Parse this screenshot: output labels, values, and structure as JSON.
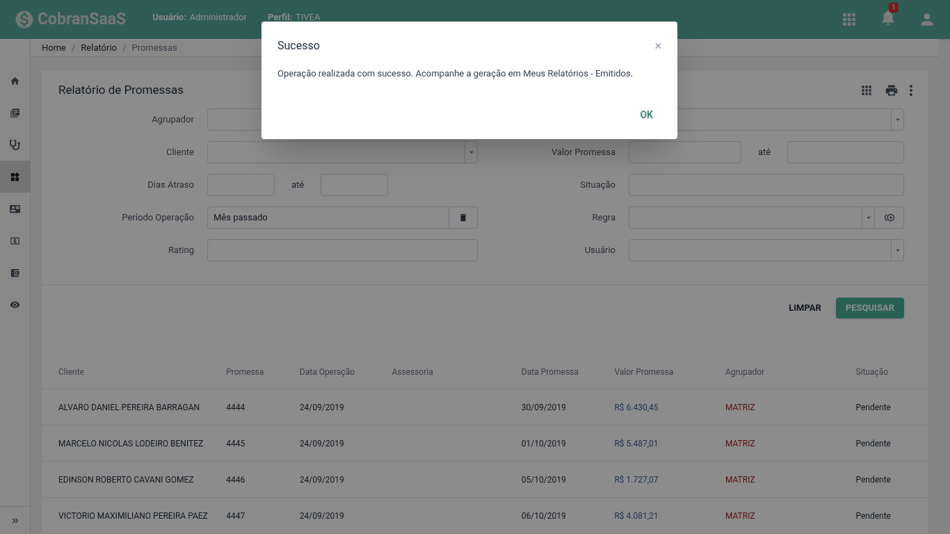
{
  "header": {
    "logo": "CobranSaaS",
    "user_label": "Usuário:",
    "user": "Administrador",
    "profile_label": "Perfil:",
    "profile": "TIVEA",
    "notifications": "1"
  },
  "sidebar": {
    "items": [
      {
        "selected": false
      },
      {
        "selected": false
      },
      {
        "selected": false
      },
      {
        "selected": true
      },
      {
        "selected": false
      },
      {
        "selected": false
      },
      {
        "selected": false
      },
      {
        "selected": false
      }
    ]
  },
  "breadcrumb": [
    "Home",
    "Relatório",
    "Promessas"
  ],
  "breadcrumb_separator": "/",
  "card": {
    "title": "Relatório de Promessas"
  },
  "filters_left": [
    {
      "label": "Agrupador",
      "kind": "text"
    },
    {
      "label": "Cliente",
      "kind": "select"
    },
    {
      "label": "Dias Atraso",
      "kind": "range",
      "separator": "até"
    },
    {
      "label": "Período Operação",
      "kind": "clearable",
      "value": "Mês passado"
    },
    {
      "label": "Rating",
      "kind": "text"
    }
  ],
  "filters_right": [
    {
      "kind": "select"
    },
    {
      "label": "Valor Promessa",
      "kind": "range",
      "separator": "até"
    },
    {
      "label": "Situação",
      "kind": "text"
    },
    {
      "label": "Regra",
      "kind": "select-add"
    },
    {
      "label": "Usuário",
      "kind": "select"
    }
  ],
  "actions": {
    "clear": "LIMPAR",
    "search": "PESQUISAR"
  },
  "table": {
    "columns": [
      "Cliente",
      "Promessa",
      "Data Operação",
      "Assessoria",
      "Data Promessa",
      "Valor Promessa",
      "Agrupador",
      "Situação"
    ],
    "rows": [
      [
        "ALVARO DANIEL PEREIRA BARRAGAN",
        "4444",
        "24/09/2019",
        "",
        "30/09/2019",
        "R$ 6.430,45",
        "MATRIZ",
        "Pendente"
      ],
      [
        "MARCELO NICOLAS LODEIRO BENITEZ",
        "4445",
        "24/09/2019",
        "",
        "01/10/2019",
        "R$ 5.487,01",
        "MATRIZ",
        "Pendente"
      ],
      [
        "EDINSON ROBERTO CAVANI GOMEZ",
        "4446",
        "24/09/2019",
        "",
        "05/10/2019",
        "R$ 1.727,07",
        "MATRIZ",
        "Pendente"
      ],
      [
        "VICTORIO MAXIMILIANO PEREIRA PAEZ",
        "4447",
        "24/09/2019",
        "",
        "06/10/2019",
        "R$ 4.081,21",
        "MATRIZ",
        "Pendente"
      ]
    ]
  },
  "dialog": {
    "title": "Sucesso",
    "close": "×",
    "message": "Operação realizada com sucesso. Acompanhe a geração em Meus Relatórios - Emitidos.",
    "ok": "OK"
  }
}
